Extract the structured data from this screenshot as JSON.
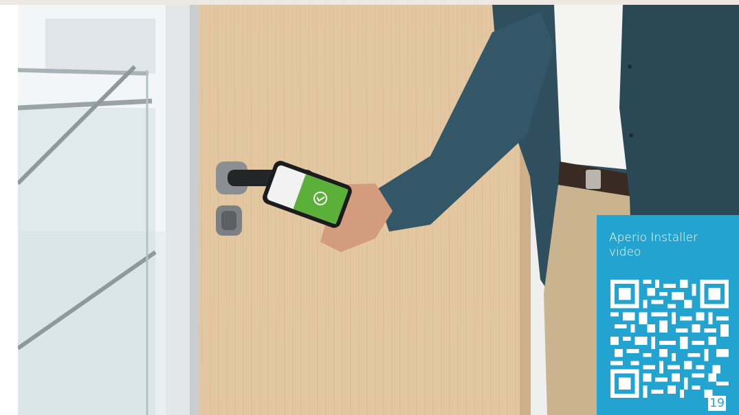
{
  "panel": {
    "caption": "Aperio Installer video",
    "page_number": "19"
  },
  "colors": {
    "accent": "#23a3cf",
    "door": "#e3c7a0",
    "jacket": "#2f4f5e",
    "phone_screen": "#5bb03a"
  },
  "icons": {
    "qr": "qr-code-icon",
    "check": "checkmark-circle-icon"
  }
}
